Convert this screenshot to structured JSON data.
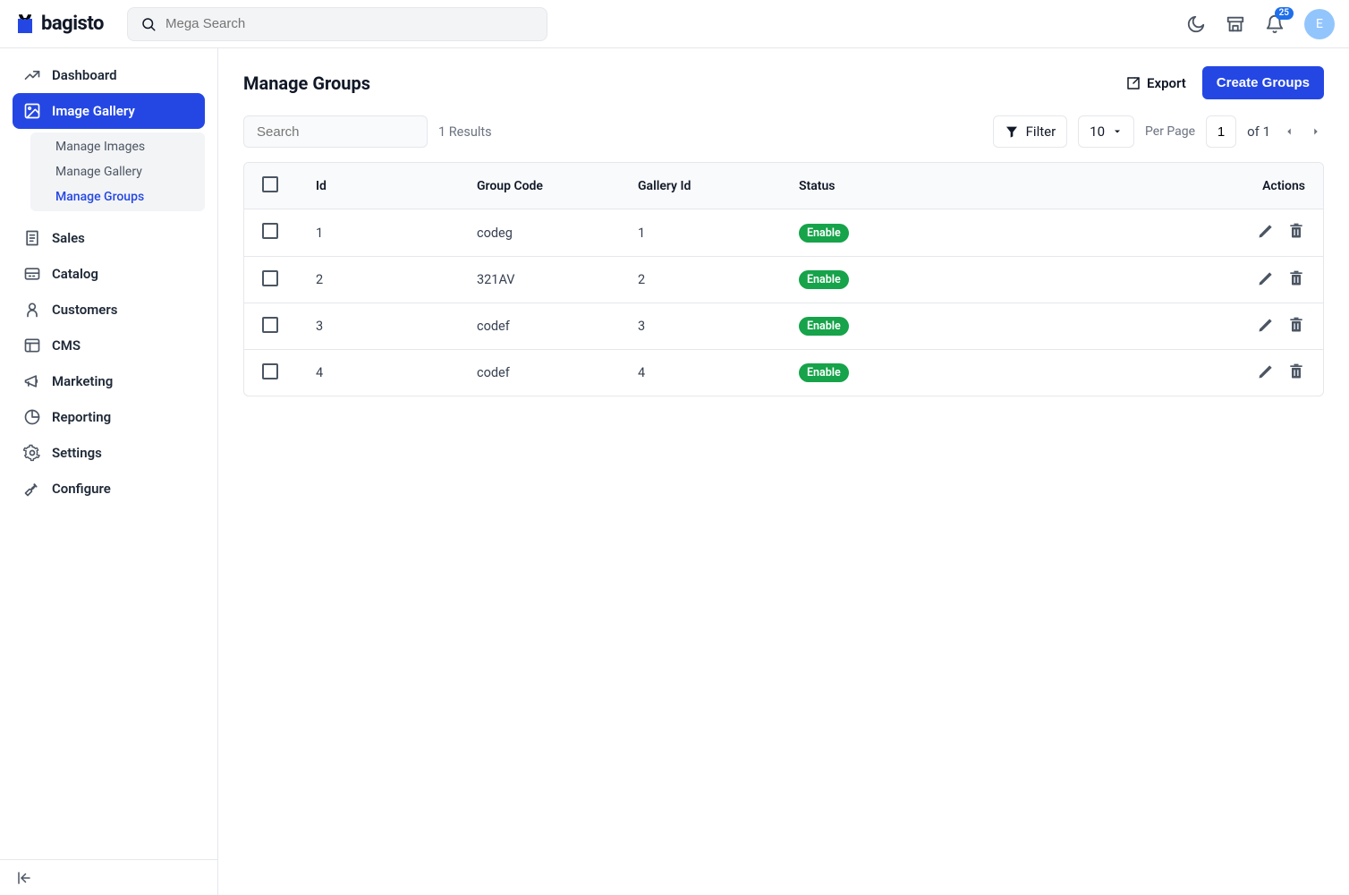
{
  "brand": "bagisto",
  "search_placeholder": "Mega Search",
  "notifications_count": "25",
  "avatar_initial": "E",
  "sidebar": {
    "items": [
      {
        "label": "Dashboard"
      },
      {
        "label": "Image Gallery"
      },
      {
        "label": "Sales"
      },
      {
        "label": "Catalog"
      },
      {
        "label": "Customers"
      },
      {
        "label": "CMS"
      },
      {
        "label": "Marketing"
      },
      {
        "label": "Reporting"
      },
      {
        "label": "Settings"
      },
      {
        "label": "Configure"
      }
    ],
    "subnav": {
      "items": [
        {
          "label": "Manage Images"
        },
        {
          "label": "Manage Gallery"
        },
        {
          "label": "Manage Groups"
        }
      ]
    }
  },
  "page": {
    "title": "Manage Groups",
    "export": "Export",
    "create": "Create Groups"
  },
  "toolbar": {
    "search_placeholder": "Search",
    "results": "1 Results",
    "filter": "Filter",
    "per_page": "10",
    "per_page_label": "Per Page",
    "current_page": "1",
    "of_pages": "of 1"
  },
  "table": {
    "headers": {
      "id": "Id",
      "group_code": "Group Code",
      "gallery_id": "Gallery Id",
      "status": "Status",
      "actions": "Actions"
    },
    "rows": [
      {
        "id": "1",
        "group_code": "codeg",
        "gallery_id": "1",
        "status": "Enable"
      },
      {
        "id": "2",
        "group_code": "321AV",
        "gallery_id": "2",
        "status": "Enable"
      },
      {
        "id": "3",
        "group_code": "codef",
        "gallery_id": "3",
        "status": "Enable"
      },
      {
        "id": "4",
        "group_code": "codef",
        "gallery_id": "4",
        "status": "Enable"
      }
    ]
  }
}
